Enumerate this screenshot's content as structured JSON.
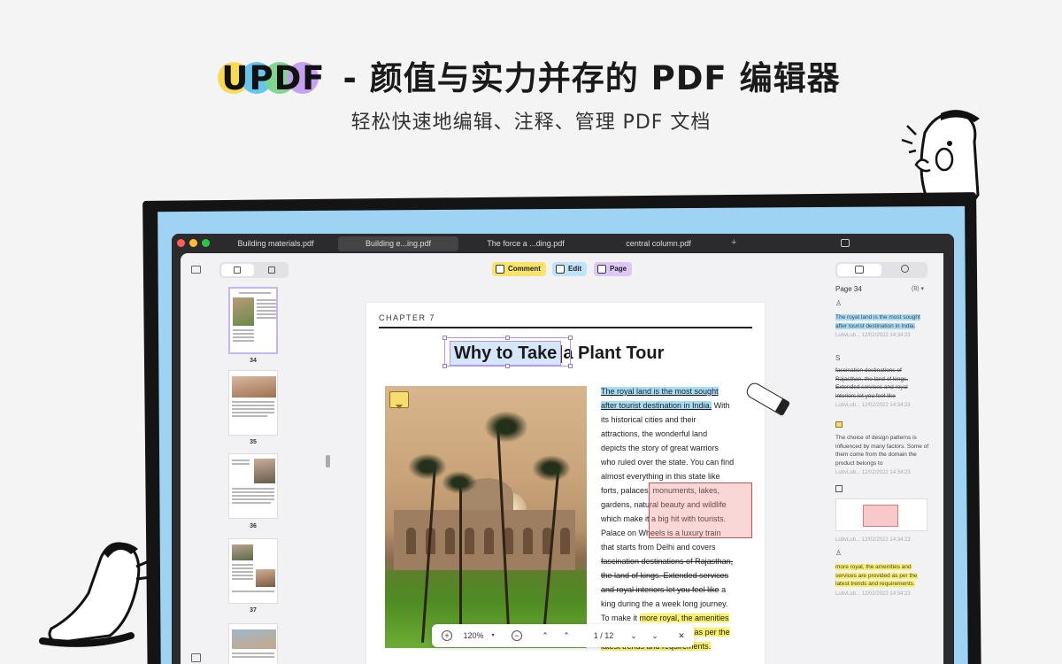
{
  "hero": {
    "brand": "UPDF",
    "headline_rest": "- 颜值与实力并存的 PDF 编辑器",
    "subheadline": "轻松快速地编辑、注释、管理 PDF 文档",
    "logo_colors": [
      "#f9d84a",
      "#5cc4f0",
      "#7ad48b",
      "#c49cf0"
    ]
  },
  "window": {
    "tabs": [
      "Building materials.pdf",
      "Building e...ing.pdf",
      "The force a ...ding.pdf",
      "central column.pdf"
    ],
    "active_tab": 1,
    "add_tab": "+"
  },
  "toolbar": {
    "comment": "Comment",
    "edit": "Edit",
    "page": "Page",
    "colors": {
      "comment": "#f8e46a",
      "edit": "#bfe3f8",
      "page": "#dcc7f5"
    }
  },
  "thumbnails": {
    "pages": [
      "34",
      "35",
      "36",
      "37"
    ]
  },
  "document": {
    "chapter": "CHAPTER 7",
    "title_highlight": "Why to Take",
    "title_rest": "a Plant Tour",
    "lines": [
      {
        "segments": [
          {
            "t": "The royal land is the most sought",
            "s": "hb"
          }
        ]
      },
      {
        "segments": [
          {
            "t": "after tourist destination in India.",
            "s": "hb"
          },
          {
            "t": " With",
            "s": ""
          }
        ]
      },
      {
        "segments": [
          {
            "t": "its historical cities and their",
            "s": ""
          }
        ]
      },
      {
        "segments": [
          {
            "t": "attractions, the wonderful land",
            "s": ""
          }
        ]
      },
      {
        "segments": [
          {
            "t": "depicts the story of great warriors",
            "s": ""
          }
        ]
      },
      {
        "segments": [
          {
            "t": "who ruled over the state. You can find",
            "s": ""
          }
        ]
      },
      {
        "segments": [
          {
            "t": "almost everything in this state like",
            "s": ""
          }
        ]
      },
      {
        "segments": [
          {
            "t": "forts, palaces, monuments, lakes,",
            "s": ""
          }
        ]
      },
      {
        "segments": [
          {
            "t": "gardens, natural beauty and wildlife",
            "s": ""
          }
        ]
      },
      {
        "segments": [
          {
            "t": "which make it a big hit with tourists.",
            "s": ""
          }
        ]
      },
      {
        "segments": [
          {
            "t": "Palace on Wheels is a luxury train",
            "s": ""
          }
        ]
      },
      {
        "segments": [
          {
            "t": "that starts from Delhi and covers",
            "s": ""
          }
        ]
      },
      {
        "segments": [
          {
            "t": "fascination destinations of Rajasthan,",
            "s": "st"
          }
        ]
      },
      {
        "segments": [
          {
            "t": "the land of kings. Extended services",
            "s": "st"
          }
        ]
      },
      {
        "segments": [
          {
            "t": "and royal interiors let you feel like",
            "s": "st"
          },
          {
            "t": " a",
            "s": ""
          }
        ]
      },
      {
        "segments": [
          {
            "t": "king during the a week long journey.",
            "s": ""
          }
        ]
      },
      {
        "segments": [
          {
            "t": "To make it ",
            "s": ""
          },
          {
            "t": "more royal, the amenities",
            "s": "hy"
          }
        ]
      },
      {
        "segments": [
          {
            "t": "and services are provided as per the",
            "s": "hy"
          }
        ]
      },
      {
        "segments": [
          {
            "t": "latest trends and requirements.",
            "s": "hy"
          }
        ]
      }
    ]
  },
  "bottombar": {
    "zoom_in": "+",
    "zoom": "120%",
    "zoom_out": "−",
    "page_indicator": "1 / 12",
    "close": "✕"
  },
  "annotations": {
    "page_label": "Page 34",
    "count": "(8)",
    "items": [
      {
        "icon": "pen-icon",
        "text": "The royal land is the most sought after tourist destination in India.",
        "style": "hb",
        "meta": "LubvLub... 12/02/2022 14:34:23"
      },
      {
        "icon": "strikethrough-icon",
        "glyph": "S",
        "text": "fascination destinations of Rajasthan, the land of kings. Extended services and royal interiors let you feel like",
        "style": "st",
        "meta": "LubvLub... 12/02/2022 14:34:23"
      },
      {
        "icon": "note-icon",
        "text": "The choice of design patterns is influenced by many factors. Some of them come from the domain the product belongs to",
        "style": "",
        "meta": "LubvLub... 12/02/2022 14:34:23"
      },
      {
        "icon": "rectangle-icon",
        "text": "",
        "style": "",
        "meta": "LubvLub... 12/02/2022 14:34:23"
      },
      {
        "icon": "pen-icon",
        "text": "more royal, the amenities and services are provided as per the latest trends and requirements.",
        "style": "hy",
        "meta": "LubvLub... 12/02/2022 14:34:23"
      }
    ]
  }
}
